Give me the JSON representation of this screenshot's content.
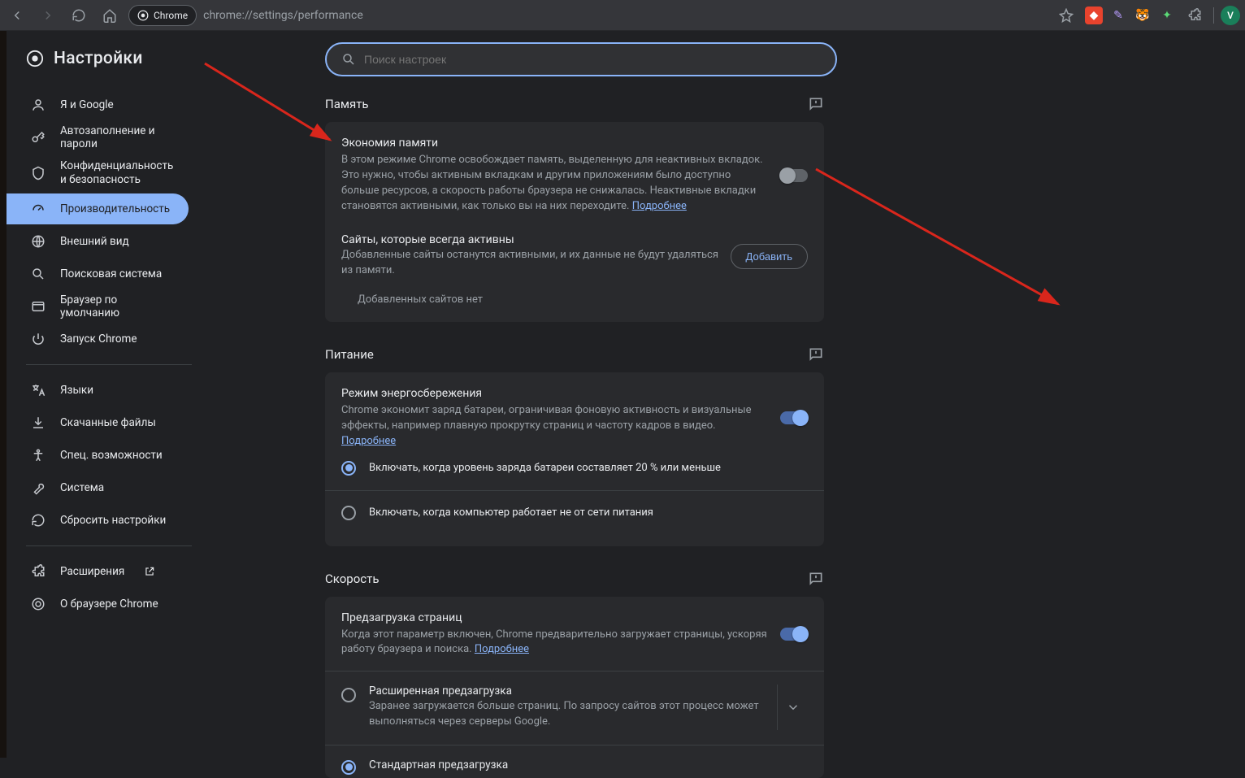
{
  "toolbar": {
    "url_prefix": "Chrome",
    "url": "chrome://settings/performance",
    "avatar_letter": "V"
  },
  "sidebar": {
    "title": "Настройки",
    "items": [
      {
        "label": "Я и Google"
      },
      {
        "label": "Автозаполнение и пароли"
      },
      {
        "label": "Конфиденциальность и безопасность"
      },
      {
        "label": "Производительность"
      },
      {
        "label": "Внешний вид"
      },
      {
        "label": "Поисковая система"
      },
      {
        "label": "Браузер по умолчанию"
      },
      {
        "label": "Запуск Chrome"
      },
      {
        "label": "Языки"
      },
      {
        "label": "Скачанные файлы"
      },
      {
        "label": "Спец. возможности"
      },
      {
        "label": "Система"
      },
      {
        "label": "Сбросить настройки"
      },
      {
        "label": "Расширения"
      },
      {
        "label": "О браузере Chrome"
      }
    ]
  },
  "search": {
    "placeholder": "Поиск настроек"
  },
  "sections": {
    "memory": {
      "heading": "Память",
      "title": "Экономия памяти",
      "desc": "В этом режиме Chrome освобождает память, выделенную для неактивных вкладок. Это нужно, чтобы активным вкладкам и другим приложениям было доступно больше ресурсов, а скорость работы браузера не снижалась. Неактивные вкладки становятся активными, как только вы на них переходите.",
      "learn_more": "Подробнее",
      "always_active_title": "Сайты, которые всегда активны",
      "always_active_desc": "Добавленные сайты останутся активными, и их данные не будут удаляться из памяти.",
      "add_btn": "Добавить",
      "empty": "Добавленных сайтов нет"
    },
    "power": {
      "heading": "Питание",
      "title": "Режим энергосбережения",
      "desc": "Chrome экономит заряд батареи, ограничивая фоновую активность и визуальные эффекты, например плавную прокрутку страниц и частоту кадров в видео.",
      "learn_more": "Подробнее",
      "option_a": "Включать, когда уровень заряда батареи составляет 20 % или меньше",
      "option_b": "Включать, когда компьютер работает не от сети питания"
    },
    "speed": {
      "heading": "Скорость",
      "title": "Предзагрузка страниц",
      "desc": "Когда этот параметр включен, Chrome предварительно загружает страницы, ускоряя работу браузера и поиска.",
      "learn_more": "Подробнее",
      "ext_title": "Расширенная предзагрузка",
      "ext_desc": "Заранее загружается больше страниц. По запросу сайтов этот процесс может выполняться через серверы Google.",
      "std_title": "Стандартная предзагрузка"
    }
  }
}
